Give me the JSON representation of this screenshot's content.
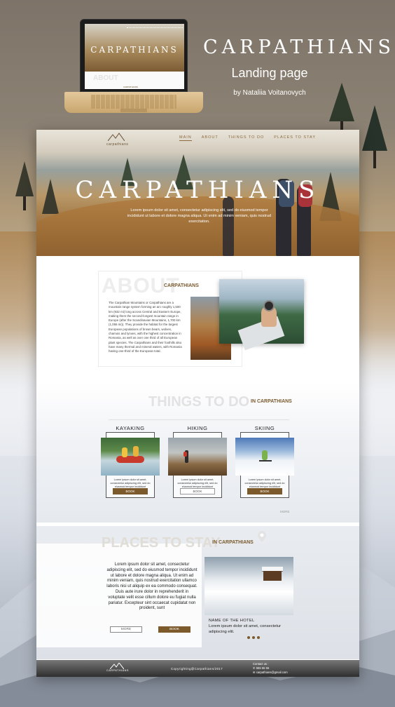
{
  "showcase": {
    "title": "CARPATHIANS",
    "subtitle": "Landing page",
    "author": "by Nataliia Voitanovych"
  },
  "laptop": {
    "screen_title": "CARPATHIANS",
    "screen_about": "ABOUT",
    "screen_label": "CARPATHIANS"
  },
  "header": {
    "logo_text": "carpathians",
    "nav": [
      "MAIN",
      "ABOUT",
      "THINGS TO DO",
      "PLACES TO STAY"
    ],
    "active_nav": "MAIN"
  },
  "hero": {
    "title": "CARPATHIANS",
    "text": "Lorem ipsum dolor sit amet, consectetur adipiscing elit, sed do eiusmod tempor incididunt ut labore et dolore magna aliqua. Ut enim ad minim veniam, quis nostrud exercitation."
  },
  "about": {
    "bg_title": "ABOUT",
    "label": "CARPATHIANS",
    "text": "The Carpathian Mountains or Carpathians are a mountain range system forming an arc roughly 1,500 km (932 mi) long across Central and Eastern Europe, making them the second-longest mountain range in Europe (after the Scandinavian Mountains, 1,700 km (1,056 mi)). They provide the habitat for the largest European populations of brown bears, wolves, chamois and lynxes, with the highest concentration in Romania, as well as over one third of all European plant species. The Carpathians and their foothills also have many thermal and mineral waters, with Romania having one-third of the European total."
  },
  "things": {
    "bg_title": "THINGS TO DO",
    "label": "IN CARPATHIANS",
    "cards": [
      {
        "title": "KAYAKING",
        "text": "Lorem ipsum dolor sit amet, consectetur adipiscing elit, sed do eiusmod tempor incididunt",
        "button": "BOOK",
        "accent": "#7d5a2b"
      },
      {
        "title": "HIKING",
        "text": "Lorem ipsum dolor sit amet, consectetur adipiscing elit, sed do eiusmod tempor incididunt",
        "button": "BOOK",
        "accent": "#ffffff"
      },
      {
        "title": "SKIING",
        "text": "Lorem ipsum dolor sit amet, consectetur adipiscing elit, sed do eiusmod tempor incididunt",
        "button": "BOOK",
        "accent": "#7d5a2b"
      }
    ],
    "more": "MORE"
  },
  "places": {
    "bg_title": "PLACES TO STAY",
    "label": "IN CARPATHIANS",
    "text": "Lorem ipsum dolor sit amet, consectetur adipiscing elit, sed do eiusmod tempor incididunt ut labore et dolore magna aliqua. Ut enim ad minim veniam, quis nostrud exercitation ullamco laboris nisi ut aliquip ex ea commodo consequat. Duis aute irure dolor in reprehenderit in voluptate velit esse cillum dolore eu fugiat nulla pariatur. Excepteur sint occaecat cupidatat non proident, sunt",
    "more_button": "MORE",
    "book_button": "BOOK",
    "hotel_name": "NAME OF THE HOTEL",
    "hotel_text": "Lorem ipsum dolor sit amet, consectetur adipiscing elit."
  },
  "footer": {
    "logo_text": "CARPATHIANS",
    "copyright": "Copyrighting@Carpathians/2017",
    "contact_title": "Contact us :",
    "phone": "555 55 55",
    "email": "carpathians@gmail.com"
  },
  "colors": {
    "accent": "#7d5a2b",
    "label": "#7a5a2e"
  }
}
